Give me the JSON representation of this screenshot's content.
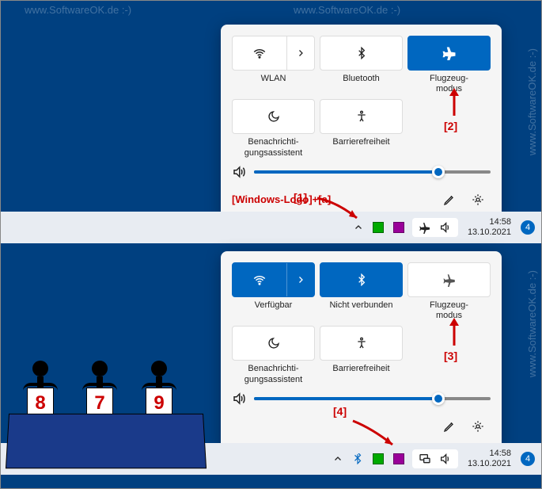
{
  "watermark": "www.SoftwareOK.de :-)",
  "panel1": {
    "tiles": {
      "wlan": "WLAN",
      "bluetooth": "Bluetooth",
      "airplane": "Flugzeug-\nmodus",
      "focus": "Benachrichti-\ngungsassistent",
      "access": "Barrierefreiheit"
    },
    "volume_pct": 78,
    "hint": "[Windows-Logo]+[a]"
  },
  "panel2": {
    "tiles": {
      "wlan": "Verfügbar",
      "bluetooth": "Nicht verbunden",
      "airplane": "Flugzeug-\nmodus",
      "focus": "Benachrichti-\ngungsassistent",
      "access": "Barrierefreiheit"
    },
    "volume_pct": 78
  },
  "annotations": {
    "a1": "[1]",
    "a2": "[2]",
    "a3": "[3]",
    "a4": "[4]"
  },
  "tray": {
    "time": "14:58",
    "date": "13.10.2021",
    "badge": "4"
  },
  "judges": {
    "scores": [
      "8",
      "7",
      "9"
    ]
  }
}
